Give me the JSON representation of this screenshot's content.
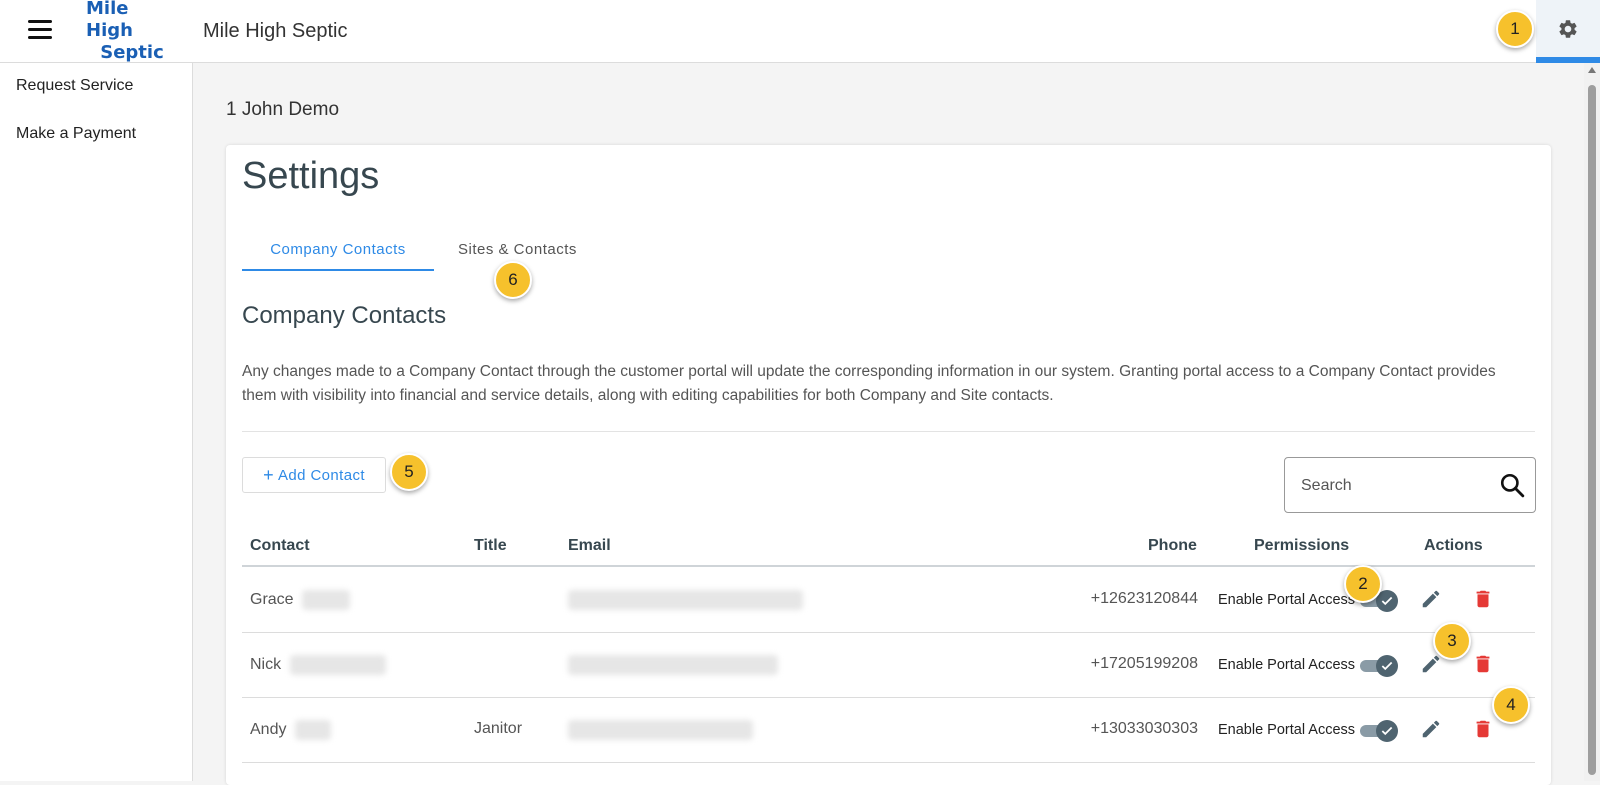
{
  "header": {
    "logo_line1": "Mile High",
    "logo_line2": "Septic",
    "app_title": "Mile High Septic"
  },
  "sidebar": {
    "items": [
      {
        "label": "Request Service"
      },
      {
        "label": "Make a Payment"
      }
    ]
  },
  "account": {
    "name": "1 John Demo"
  },
  "settings": {
    "title": "Settings",
    "tabs": [
      {
        "label": "Company Contacts",
        "active": true
      },
      {
        "label": "Sites & Contacts",
        "active": false
      }
    ],
    "section_title": "Company Contacts",
    "description": "Any changes made to a Company Contact through the customer portal will update the corresponding information in our system. Granting portal access to a Company Contact provides them with visibility into financial and service details, along with editing capabilities for both Company and Site contacts.",
    "add_contact_label": "Add Contact",
    "search": {
      "placeholder": "Search",
      "value": ""
    }
  },
  "table": {
    "headers": {
      "contact": "Contact",
      "title": "Title",
      "email": "Email",
      "phone": "Phone",
      "permissions": "Permissions",
      "actions": "Actions"
    },
    "rows": [
      {
        "first_name": "Grace",
        "title": "",
        "phone": "+12623120844",
        "permission_label": "Enable Portal Access",
        "portal_access": true
      },
      {
        "first_name": "Nick",
        "title": "",
        "phone": "+17205199208",
        "permission_label": "Enable Portal Access",
        "portal_access": true
      },
      {
        "first_name": "Andy",
        "title": "Janitor",
        "phone": "+13033030303",
        "permission_label": "Enable Portal Access",
        "portal_access": true
      }
    ]
  },
  "callouts": [
    "1",
    "2",
    "3",
    "4",
    "5",
    "6"
  ],
  "colors": {
    "accent": "#2e8ae6",
    "brand": "#1a5fb4",
    "callout": "#f6c12c",
    "delete": "#e53935",
    "toggle": "#4f6470"
  }
}
